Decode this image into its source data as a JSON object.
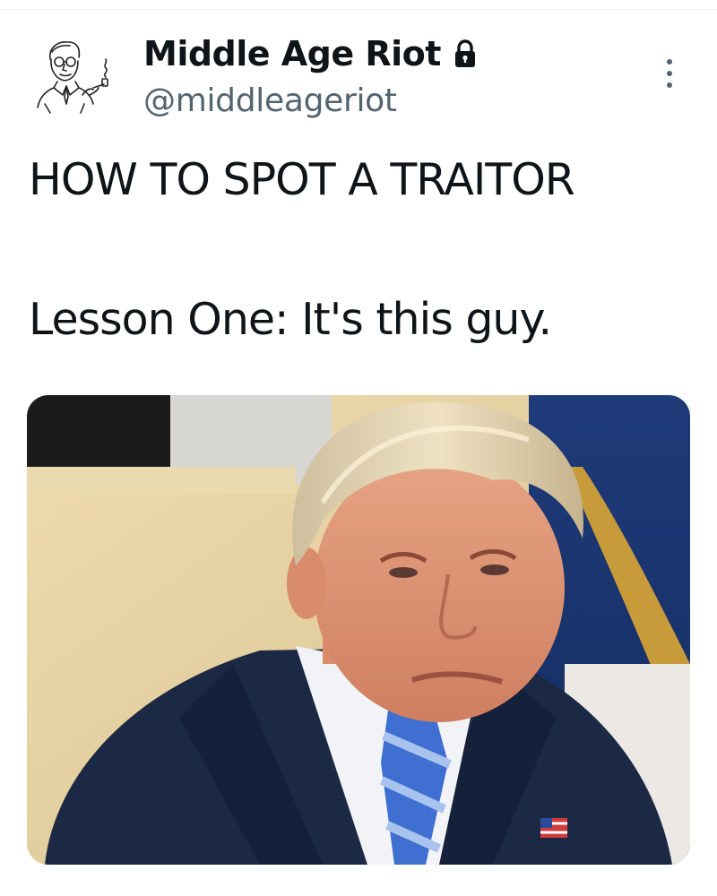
{
  "tweet": {
    "author": {
      "display_name": "Middle Age Riot",
      "handle": "@middleageriot",
      "avatar_icon": "vintage-man-with-pipe-avatar",
      "protected_icon": "lock-icon"
    },
    "more_icon": "more-vertical-icon",
    "text_lines": [
      "HOW TO SPOT A TRAITOR",
      "Lesson One: It's this guy."
    ],
    "media": {
      "type": "photo"
    }
  },
  "colors": {
    "text_primary": "#0f1419",
    "text_secondary": "#536471",
    "divider": "#eff3f4"
  }
}
